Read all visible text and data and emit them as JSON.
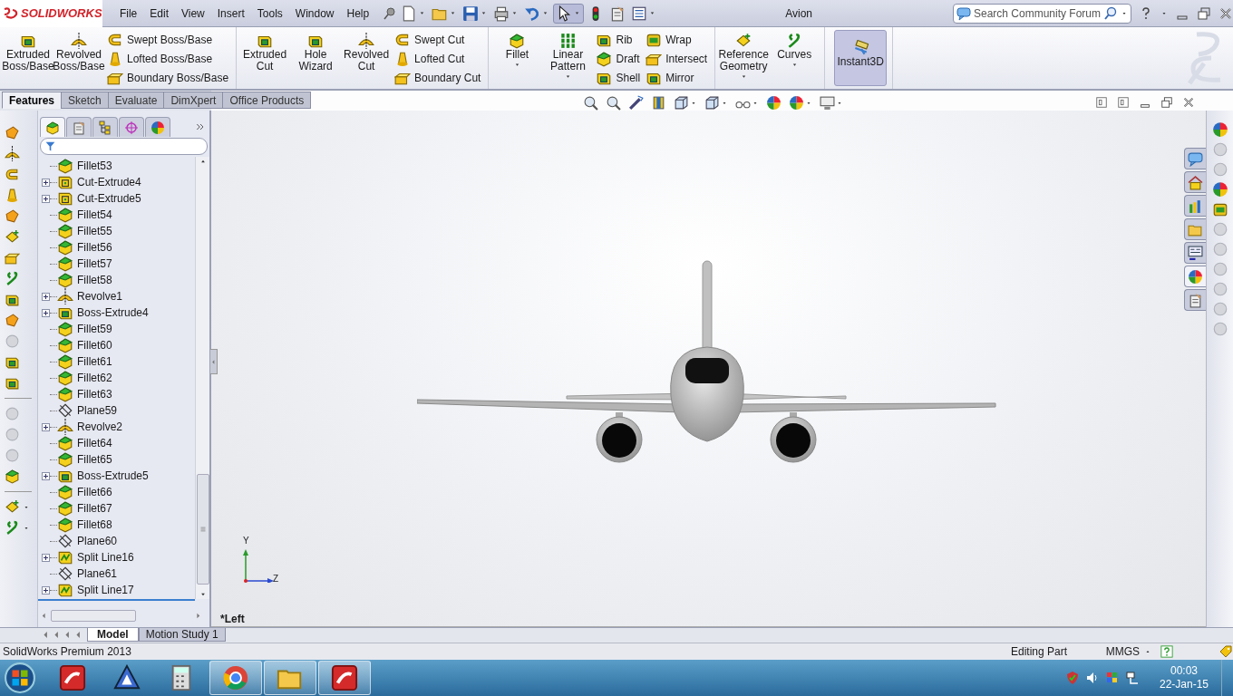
{
  "app_bar": {
    "logo": "SOLIDWORKS",
    "menu": [
      "File",
      "Edit",
      "View",
      "Insert",
      "Tools",
      "Window",
      "Help"
    ],
    "title": "Avion",
    "search": {
      "placeholder": "Search Community Forum"
    }
  },
  "ribbon": [
    {
      "columns": [
        {
          "kind": "large",
          "label": "Extruded Boss/Base",
          "dropdown": false,
          "on": false
        },
        {
          "kind": "large",
          "label": "Revolved Boss/Base",
          "dropdown": false,
          "on": false
        },
        {
          "kind": "stack",
          "buttons": [
            "Swept Boss/Base",
            "Lofted Boss/Base",
            "Boundary Boss/Base"
          ]
        }
      ]
    },
    {
      "columns": [
        {
          "kind": "large",
          "label": "Extruded Cut",
          "dropdown": false,
          "on": false
        },
        {
          "kind": "large",
          "label": "Hole Wizard",
          "dropdown": false,
          "on": false
        },
        {
          "kind": "large",
          "label": "Revolved Cut",
          "dropdown": false,
          "on": false
        },
        {
          "kind": "stack",
          "buttons": [
            "Swept Cut",
            "Lofted Cut",
            "Boundary Cut"
          ]
        }
      ]
    },
    {
      "columns": [
        {
          "kind": "large",
          "label": "Fillet",
          "dropdown": true,
          "on": false
        },
        {
          "kind": "large",
          "label": "Linear Pattern",
          "dropdown": true,
          "on": false
        },
        {
          "kind": "stack",
          "buttons": [
            "Rib",
            "Draft",
            "Shell"
          ]
        },
        {
          "kind": "stack",
          "buttons": [
            "Wrap",
            "Intersect",
            "Mirror"
          ]
        }
      ]
    },
    {
      "columns": [
        {
          "kind": "large",
          "label": "Reference Geometry",
          "dropdown": true,
          "on": false
        },
        {
          "kind": "large",
          "label": "Curves",
          "dropdown": true,
          "on": false
        }
      ]
    },
    {
      "columns": [
        {
          "kind": "large",
          "label": "Instant3D",
          "dropdown": false,
          "on": true
        }
      ]
    }
  ],
  "manager_tabs": [
    {
      "selected": true
    },
    {
      "selected": false
    },
    {
      "selected": false
    },
    {
      "selected": false
    },
    {
      "selected": false
    }
  ],
  "task_pane_tabs": [
    {
      "selected": false
    },
    {
      "selected": false
    },
    {
      "selected": false
    },
    {
      "selected": false
    },
    {
      "selected": false
    },
    {
      "selected": true
    },
    {
      "selected": false
    }
  ],
  "command_tabs": [
    {
      "label": "Features",
      "selected": true
    },
    {
      "label": "Sketch",
      "selected": false
    },
    {
      "label": "Evaluate",
      "selected": false
    },
    {
      "label": "DimXpert",
      "selected": false
    },
    {
      "label": "Office Products",
      "selected": false
    }
  ],
  "feature_tree": [
    {
      "label": "Fillet53",
      "kind": "fillet",
      "expandable": false
    },
    {
      "label": "Cut-Extrude4",
      "kind": "cut",
      "expandable": true
    },
    {
      "label": "Cut-Extrude5",
      "kind": "cut",
      "expandable": true
    },
    {
      "label": "Fillet54",
      "kind": "fillet",
      "expandable": false
    },
    {
      "label": "Fillet55",
      "kind": "fillet",
      "expandable": false
    },
    {
      "label": "Fillet56",
      "kind": "fillet",
      "expandable": false
    },
    {
      "label": "Fillet57",
      "kind": "fillet",
      "expandable": false
    },
    {
      "label": "Fillet58",
      "kind": "fillet",
      "expandable": false
    },
    {
      "label": "Revolve1",
      "kind": "revolve",
      "expandable": true
    },
    {
      "label": "Boss-Extrude4",
      "kind": "boss",
      "expandable": true
    },
    {
      "label": "Fillet59",
      "kind": "fillet",
      "expandable": false
    },
    {
      "label": "Fillet60",
      "kind": "fillet",
      "expandable": false
    },
    {
      "label": "Fillet61",
      "kind": "fillet",
      "expandable": false
    },
    {
      "label": "Fillet62",
      "kind": "fillet",
      "expandable": false
    },
    {
      "label": "Fillet63",
      "kind": "fillet",
      "expandable": false
    },
    {
      "label": "Plane59",
      "kind": "plane",
      "expandable": false
    },
    {
      "label": "Revolve2",
      "kind": "revolve",
      "expandable": true
    },
    {
      "label": "Fillet64",
      "kind": "fillet",
      "expandable": false
    },
    {
      "label": "Fillet65",
      "kind": "fillet",
      "expandable": false
    },
    {
      "label": "Boss-Extrude5",
      "kind": "boss",
      "expandable": true
    },
    {
      "label": "Fillet66",
      "kind": "fillet",
      "expandable": false
    },
    {
      "label": "Fillet67",
      "kind": "fillet",
      "expandable": false
    },
    {
      "label": "Fillet68",
      "kind": "fillet",
      "expandable": false
    },
    {
      "label": "Plane60",
      "kind": "plane",
      "expandable": false
    },
    {
      "label": "Split Line16",
      "kind": "split",
      "expandable": true
    },
    {
      "label": "Plane61",
      "kind": "plane",
      "expandable": false
    },
    {
      "label": "Split Line17",
      "kind": "split",
      "expandable": true
    }
  ],
  "viewport": {
    "view_label": "*Left",
    "triad": [
      "Y",
      "Z"
    ]
  },
  "document_tabs": [
    {
      "label": "Model",
      "selected": true
    },
    {
      "label": "Motion Study 1",
      "selected": false
    }
  ],
  "status_bar": {
    "product": "SolidWorks Premium 2013",
    "mode": "Editing Part",
    "units": "MMGS"
  },
  "taskbar": {
    "apps": [
      {
        "running": false
      },
      {
        "running": false
      },
      {
        "running": false
      },
      {
        "running": true
      },
      {
        "running": true
      },
      {
        "running": true
      }
    ],
    "time": "00:03",
    "date": "22-Jan-15"
  }
}
